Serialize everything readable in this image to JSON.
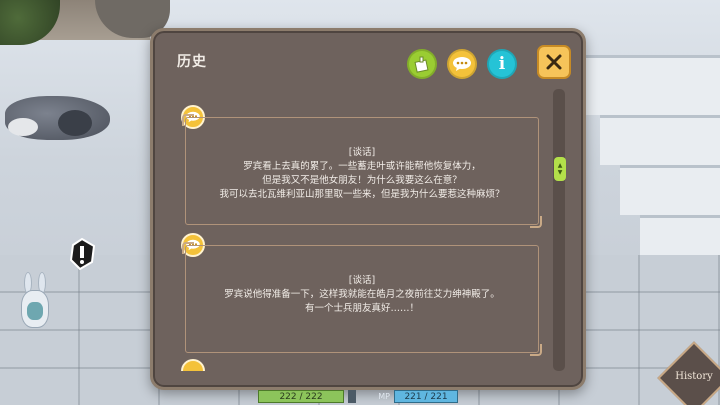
{
  "panel": {
    "title": "历史",
    "buttons": {
      "info_label": "i"
    }
  },
  "entries": [
    {
      "header": "[谈话]",
      "lines": [
        "罗宾看上去真的累了。一些蓄走叶或许能帮他恢复体力，",
        "但是我又不是他女朋友！为什么我要这么在意？",
        "我可以去北瓦维利亚山那里取一些来，但是我为什么要惹这种麻烦？"
      ]
    },
    {
      "header": "[谈话]",
      "lines": [
        "罗宾说他得准备一下，这样我就能在皓月之夜前往艾力绅神殿了。",
        "有一个士兵朋友真好……！"
      ]
    }
  ],
  "hud": {
    "hp": "222 / 222",
    "mp_label": "MP",
    "mp": "221 / 221"
  },
  "history_button": "History",
  "colors": {
    "panel_bg": "#6e625d",
    "accent_yellow": "#f4c23a",
    "accent_green": "#9acd32",
    "accent_cyan": "#25c3d6",
    "close_orange": "#f6c45a"
  }
}
